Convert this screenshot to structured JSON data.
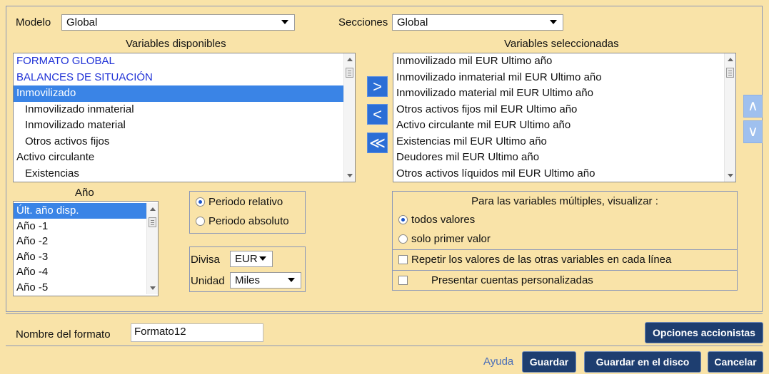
{
  "modelo": {
    "label": "Modelo",
    "value": "Global"
  },
  "secciones": {
    "label": "Secciones",
    "value": "Global"
  },
  "available": {
    "title": "Variables disponibles",
    "items": [
      {
        "text": "FORMATO GLOBAL",
        "style": "blue"
      },
      {
        "text": "BALANCES DE SITUACIÓN",
        "style": "blue"
      },
      {
        "text": "Inmovilizado",
        "style": "sel"
      },
      {
        "text": "Inmovilizado inmaterial",
        "style": "indent"
      },
      {
        "text": "Inmovilizado material",
        "style": "indent"
      },
      {
        "text": "Otros activos fijos",
        "style": "indent"
      },
      {
        "text": "Activo circulante",
        "style": ""
      },
      {
        "text": "Existencias",
        "style": "indent"
      }
    ]
  },
  "selected": {
    "title": "Variables seleccionadas",
    "items": [
      "Inmovilizado mil EUR Ultimo año",
      "Inmovilizado inmaterial mil EUR Ultimo año",
      "Inmovilizado material mil EUR Ultimo año",
      "Otros activos fijos mil EUR Ultimo año",
      "Activo circulante mil EUR Ultimo año",
      "Existencias mil EUR Ultimo año",
      "Deudores mil EUR Ultimo año",
      "Otros activos líquidos mil EUR Ultimo año"
    ]
  },
  "transfer": {
    "add": ">",
    "remove": "<",
    "remove_all": "≪"
  },
  "order": {
    "up": "∧",
    "down": "∨"
  },
  "year": {
    "title": "Año",
    "items": [
      "Últ. año disp.",
      "Año -1",
      "Año -2",
      "Año -3",
      "Año -4",
      "Año -5"
    ]
  },
  "period": {
    "relative": "Periodo relativo",
    "absolute": "Periodo absoluto"
  },
  "currency": {
    "divisa_label": "Divisa",
    "divisa_value": "EUR",
    "unidad_label": "Unidad",
    "unidad_value": "Miles"
  },
  "multiple": {
    "title": "Para las variables múltiples, visualizar :",
    "all": "todos valores",
    "first": "solo primer valor",
    "repeat": "Repetir los valores de las otras variables en cada línea",
    "custom": "Presentar cuentas personalizadas"
  },
  "format_name": {
    "label": "Nombre del formato",
    "value": "Formato12"
  },
  "buttons": {
    "shareholders": "Opciones accionistas",
    "help": "Ayuda",
    "save": "Guardar",
    "save_disk": "Guardar en el disco",
    "cancel": "Cancelar"
  },
  "colors": {
    "background": "#f9e3a8",
    "selection": "#3a84e6",
    "blue_text": "#1f31d6",
    "navy_button": "#1e3e70"
  }
}
